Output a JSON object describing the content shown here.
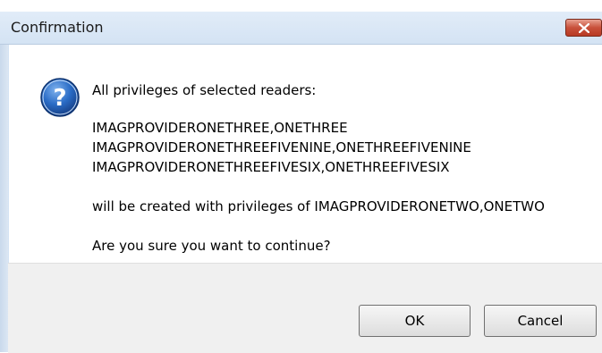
{
  "window": {
    "title": "Confirmation"
  },
  "message": {
    "intro": "All privileges of selected readers:",
    "readers": [
      "IMAGPROVIDERONETHREE,ONETHREE",
      "IMAGPROVIDERONETHREEFIVENINE,ONETHREEFIVENINE",
      "IMAGPROVIDERONETHREEFIVESIX,ONETHREEFIVESIX"
    ],
    "target": "will be created with privileges of IMAGPROVIDERONETWO,ONETWO",
    "question": "Are you sure you want to continue?"
  },
  "buttons": {
    "ok": "OK",
    "cancel": "Cancel"
  },
  "icons": {
    "dialog_icon": "question-icon",
    "close": "close-icon"
  },
  "colors": {
    "close_button": "#c8503a",
    "question_icon": "#1f5fb4"
  }
}
